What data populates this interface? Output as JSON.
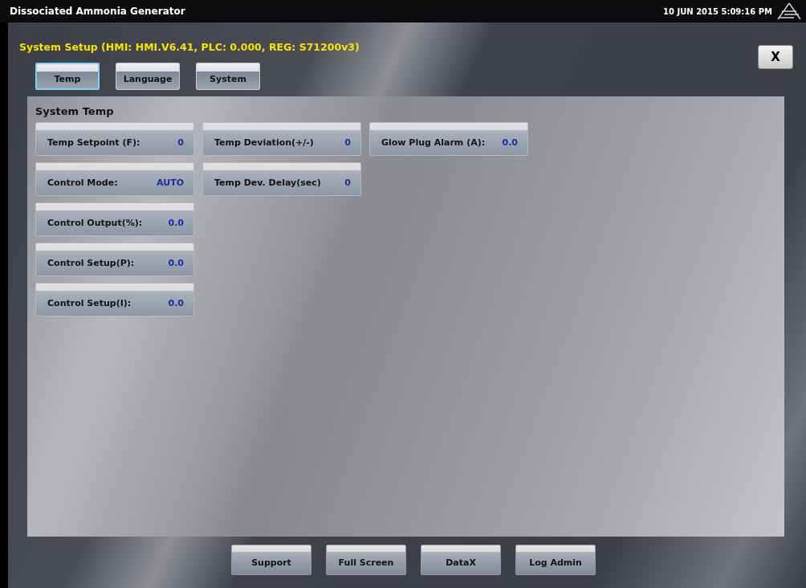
{
  "window": {
    "title": "Dissociated Ammonia Generator",
    "datetime": "10 JUN 2015 5:09:16 PM"
  },
  "dialog": {
    "title": "System Setup (HMI: HMI.V6.41, PLC: 0.000, REG: S71200v3)",
    "close": "X",
    "tabs": [
      {
        "label": "Temp",
        "selected": true
      },
      {
        "label": "Language",
        "selected": false
      },
      {
        "label": "System",
        "selected": false
      }
    ],
    "section": "System Temp",
    "columns": [
      {
        "fields": [
          {
            "label": "Temp Setpoint (F):",
            "value": "0"
          },
          {
            "label": "Control Mode:",
            "value": "AUTO"
          },
          {
            "label": "Control Output(%):",
            "value": "0.0"
          },
          {
            "label": "Control Setup(P):",
            "value": "0.0"
          },
          {
            "label": "Control Setup(I):",
            "value": "0.0"
          }
        ]
      },
      {
        "fields": [
          {
            "label": "Temp Deviation(+/-)",
            "value": "0"
          },
          {
            "label": "Temp Dev. Delay(sec)",
            "value": "0"
          }
        ]
      },
      {
        "fields": [
          {
            "label": "Glow Plug Alarm (A):",
            "value": "0.0"
          }
        ]
      }
    ],
    "buttons": [
      "Support",
      "Full Screen",
      "DataX",
      "Log Admin"
    ]
  }
}
